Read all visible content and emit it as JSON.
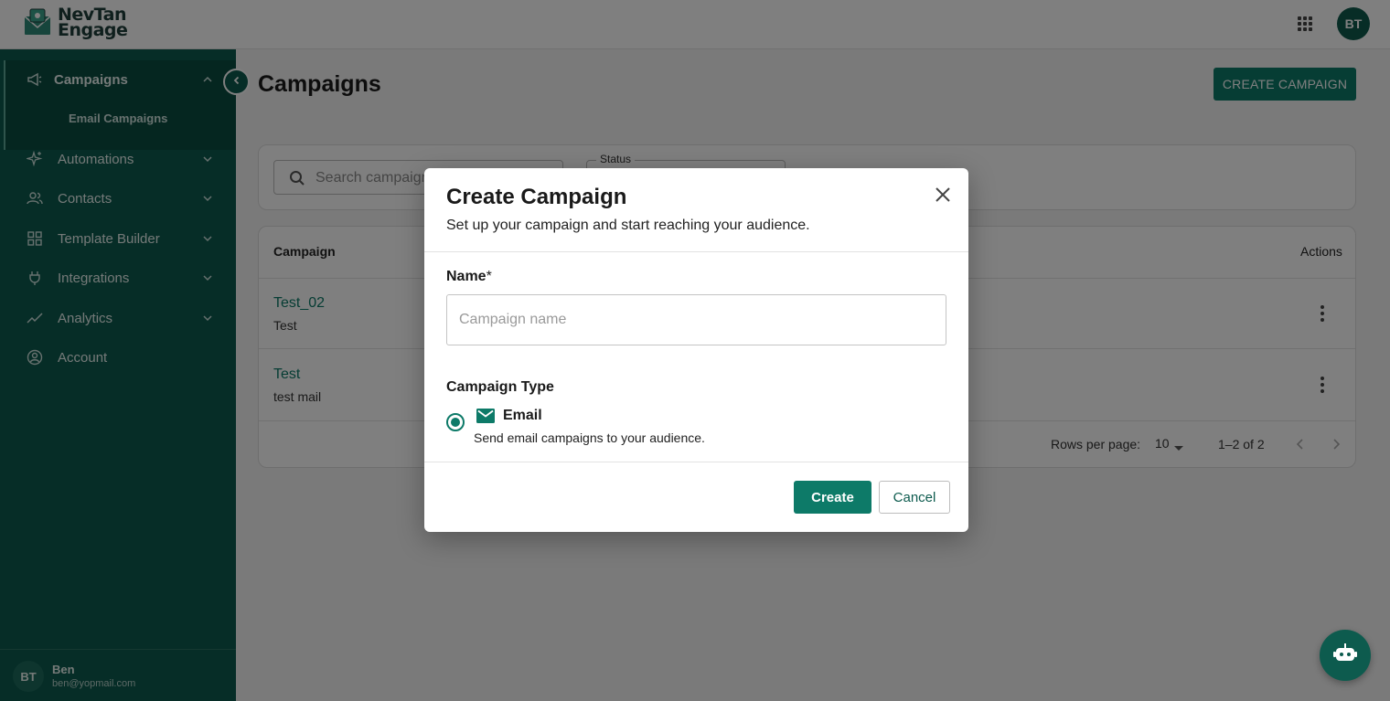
{
  "brand": {
    "line1": "NevTan",
    "line2": "Engage"
  },
  "header": {
    "avatar_initials": "BT"
  },
  "sidebar": {
    "items": [
      {
        "label": "Campaigns",
        "icon": "megaphone-icon"
      },
      {
        "label": "Automations",
        "icon": "sparkle-icon"
      },
      {
        "label": "Contacts",
        "icon": "people-icon"
      },
      {
        "label": "Template Builder",
        "icon": "grid-icon"
      },
      {
        "label": "Integrations",
        "icon": "plug-icon"
      },
      {
        "label": "Analytics",
        "icon": "trend-icon"
      },
      {
        "label": "Account",
        "icon": "user-circle-icon"
      }
    ],
    "sub_item": "Email Campaigns",
    "user": {
      "initials": "BT",
      "name": "Ben",
      "email": "ben@yopmail.com"
    }
  },
  "main": {
    "title": "Campaigns",
    "create_label": "CREATE CAMPAIGN",
    "search_placeholder": "Search campaign",
    "status_label": "Status",
    "table": {
      "col_campaign": "Campaign",
      "col_actions": "Actions",
      "rows": [
        {
          "name": "Test_02",
          "description": "Test"
        },
        {
          "name": "Test",
          "description": "test mail"
        }
      ],
      "rows_per_page_label": "Rows per page:",
      "rows_per_page": "10",
      "range": "1–2 of 2"
    }
  },
  "modal": {
    "title": "Create Campaign",
    "subtitle": "Set up your campaign and start reaching your audience.",
    "name_label": "Name",
    "required_mark": "*",
    "name_placeholder": "Campaign name",
    "name_value": "",
    "type_label": "Campaign Type",
    "option_title": "Email",
    "option_desc": "Send email campaigns to your audience.",
    "create_label": "Create",
    "cancel_label": "Cancel"
  },
  "colors": {
    "primary": "#0d7a68",
    "sidebar": "#0d5b4e"
  }
}
